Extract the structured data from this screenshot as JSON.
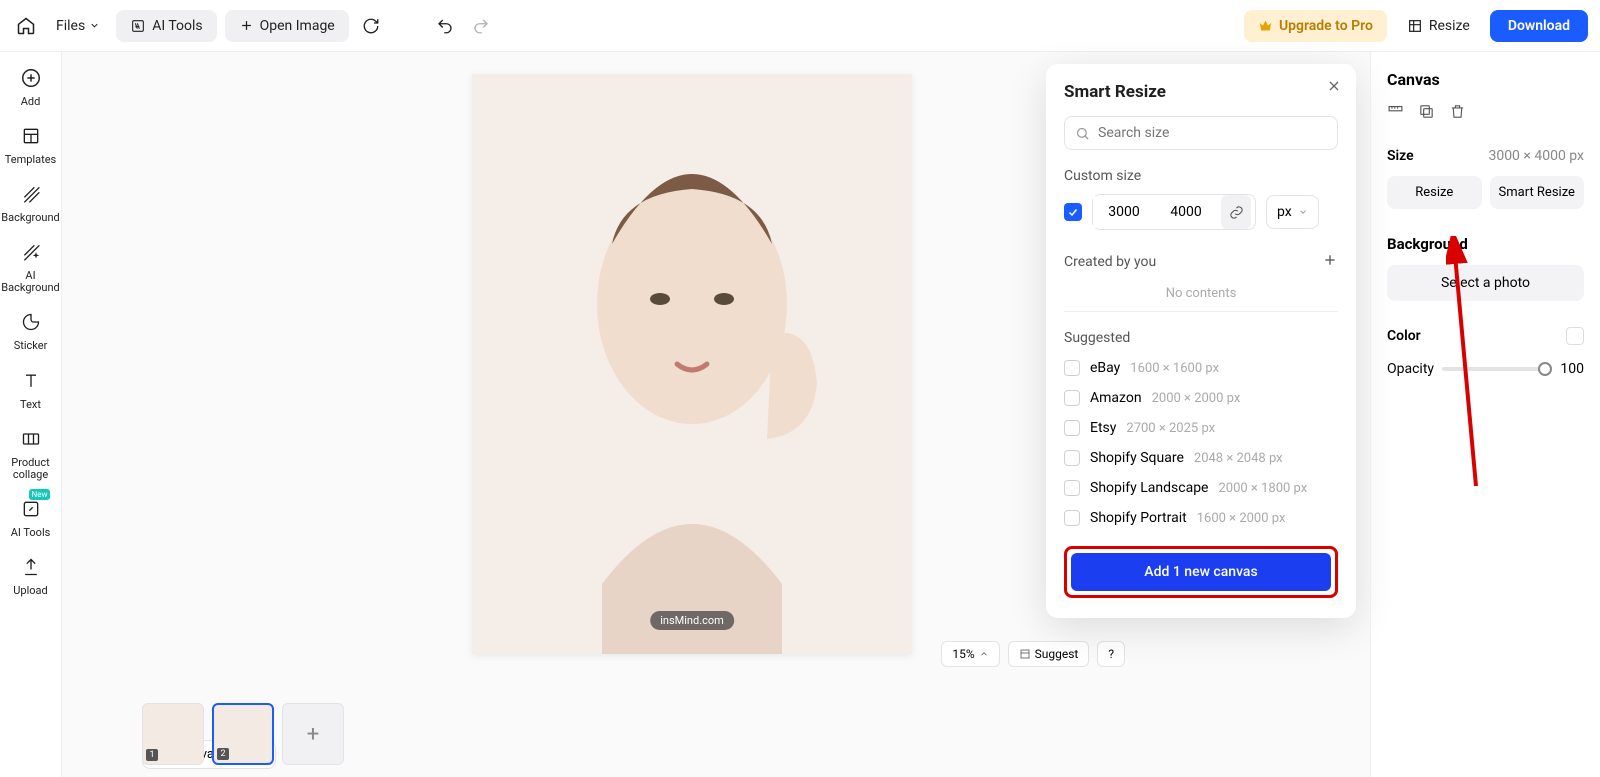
{
  "topbar": {
    "files": "Files",
    "ai_tools": "AI Tools",
    "open_image": "Open Image",
    "upgrade": "Upgrade to Pro",
    "resize": "Resize",
    "download": "Download"
  },
  "leftbar": [
    {
      "id": "add",
      "label": "Add"
    },
    {
      "id": "templates",
      "label": "Templates"
    },
    {
      "id": "background",
      "label": "Background"
    },
    {
      "id": "ai-bg",
      "label": "AI Background"
    },
    {
      "id": "sticker",
      "label": "Sticker"
    },
    {
      "id": "text",
      "label": "Text"
    },
    {
      "id": "collage",
      "label": "Product collage"
    },
    {
      "id": "ai-tools",
      "label": "AI Tools",
      "badge": "New"
    },
    {
      "id": "upload",
      "label": "Upload"
    }
  ],
  "watermark": "insMind.com",
  "canvas_selector": "Canvas 2/2",
  "zoom": {
    "value": "15%",
    "suggest": "Suggest",
    "help": "?"
  },
  "panel": {
    "title": "Smart Resize",
    "search_placeholder": "Search size",
    "custom_label": "Custom size",
    "width": "3000",
    "height": "4000",
    "unit": "px",
    "created_label": "Created by you",
    "no_contents": "No contents",
    "suggested_label": "Suggested",
    "suggested": [
      {
        "name": "eBay",
        "dims": "1600 × 1600 px"
      },
      {
        "name": "Amazon",
        "dims": "2000 × 2000 px"
      },
      {
        "name": "Etsy",
        "dims": "2700 × 2025 px"
      },
      {
        "name": "Shopify Square",
        "dims": "2048 × 2048 px"
      },
      {
        "name": "Shopify Landscape",
        "dims": "2000 × 1800 px"
      },
      {
        "name": "Shopify Portrait",
        "dims": "1600 × 2000 px"
      }
    ],
    "add_button": "Add 1 new canvas"
  },
  "rbar": {
    "title": "Canvas",
    "size_label": "Size",
    "size_value": "3000 × 4000 px",
    "resize": "Resize",
    "smart_resize": "Smart Resize",
    "bg_label": "Background",
    "select_photo": "Select a photo",
    "color_label": "Color",
    "opacity_label": "Opacity",
    "opacity_value": "100"
  }
}
